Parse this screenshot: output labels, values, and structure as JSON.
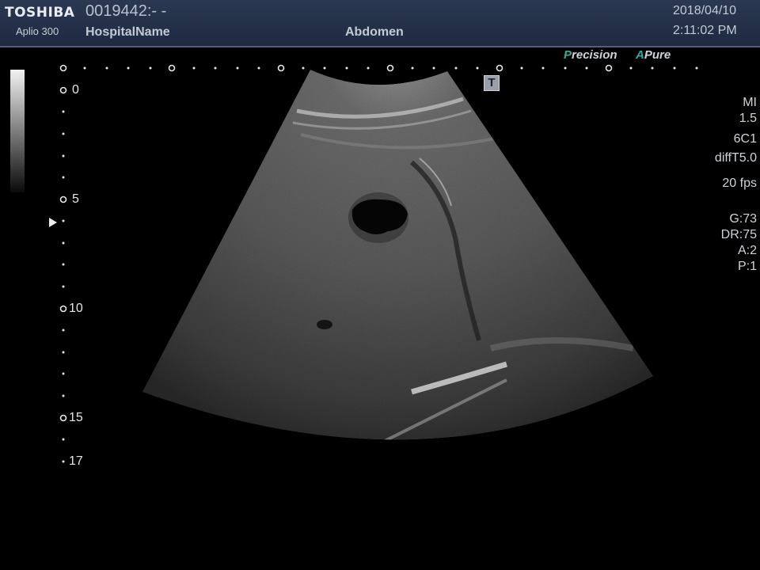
{
  "header": {
    "brand": "TOSHIBA",
    "model": "Aplio 300",
    "patient_id": "0019442:- -",
    "hospital": "HospitalName",
    "exam": "Abdomen",
    "date": "2018/04/10",
    "time": "2:11:02 PM"
  },
  "modes": {
    "precision_initial": "P",
    "precision_rest": "recision",
    "apure_initial": "A",
    "apure_rest": "Pure"
  },
  "params": {
    "mi_label": "MI",
    "mi_value": "1.5",
    "probe": "6C1",
    "preset": "diffT5.0",
    "fps": "20 fps",
    "gain": "G:73",
    "dynamic_range": "DR:75",
    "a": "A:2",
    "p": "P:1"
  },
  "depth_scale": {
    "d0": "0",
    "d5": "5",
    "d10": "10",
    "d15": "15",
    "d17": "17"
  },
  "marker_t": "T",
  "colors": {
    "accent": "#2fae9f",
    "topbar": "#243048",
    "text": "#cfd4da"
  }
}
